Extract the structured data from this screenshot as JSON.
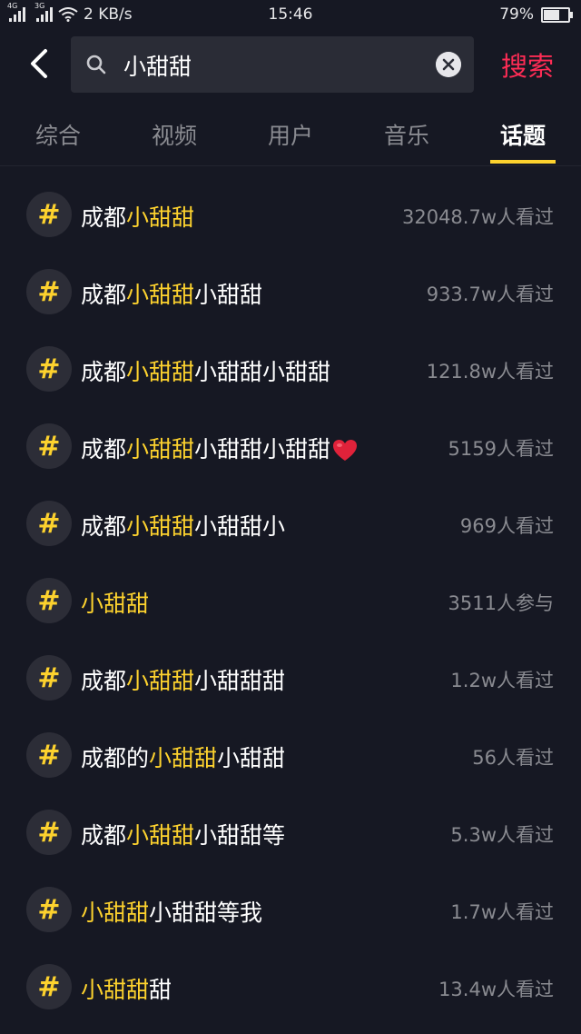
{
  "status_bar": {
    "network_1": "4G",
    "network_2": "3G",
    "speed": "2 KB/s",
    "time": "15:46",
    "battery": "79%",
    "battery_level": 0.79
  },
  "search": {
    "query": "小甜甜",
    "submit_label": "搜索"
  },
  "tabs": [
    {
      "label": "综合",
      "active": false
    },
    {
      "label": "视频",
      "active": false
    },
    {
      "label": "用户",
      "active": false
    },
    {
      "label": "音乐",
      "active": false
    },
    {
      "label": "话题",
      "active": true
    }
  ],
  "colors": {
    "background": "#161823",
    "highlight": "#fdd22e",
    "accent": "#fe2c55",
    "muted": "#8a8b91"
  },
  "topics": [
    {
      "pre": "成都",
      "hl": "小甜甜",
      "post": "",
      "views": "32048.7w人看过"
    },
    {
      "pre": "成都",
      "hl": "小甜甜",
      "post": "小甜甜",
      "views": "933.7w人看过"
    },
    {
      "pre": "成都",
      "hl": "小甜甜",
      "post": "小甜甜小甜甜",
      "views": "121.8w人看过"
    },
    {
      "pre": "成都",
      "hl": "小甜甜",
      "post": "小甜甜小甜甜",
      "views": "5159人看过",
      "emoji": "heart-icon"
    },
    {
      "pre": "成都",
      "hl": "小甜甜",
      "post": "小甜甜小",
      "views": "969人看过"
    },
    {
      "pre": "",
      "hl": "小甜甜",
      "post": "",
      "views": "3511人参与"
    },
    {
      "pre": "成都",
      "hl": "小甜甜",
      "post": "小甜甜甜",
      "views": "1.2w人看过"
    },
    {
      "pre": "成都的",
      "hl": "小甜甜",
      "post": "小甜甜",
      "views": "56人看过"
    },
    {
      "pre": "成都",
      "hl": "小甜甜",
      "post": "小甜甜等",
      "views": "5.3w人看过"
    },
    {
      "pre": "",
      "hl": "小甜甜",
      "post": "小甜甜等我",
      "views": "1.7w人看过"
    },
    {
      "pre": "",
      "hl": "小甜甜",
      "post": "甜",
      "views": "13.4w人看过"
    }
  ]
}
